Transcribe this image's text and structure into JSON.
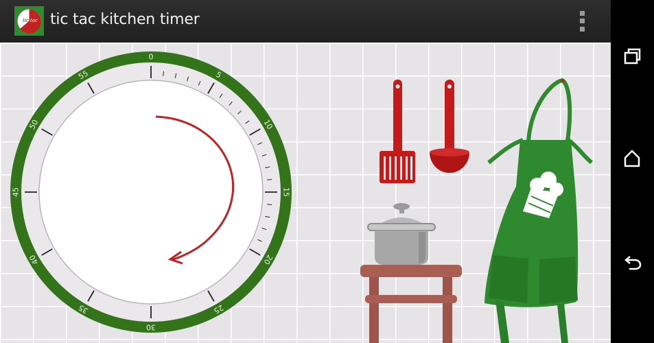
{
  "app": {
    "title": "tic tac kitchen timer",
    "icon_text_left": "tic",
    "icon_text_right": "tac"
  },
  "timer": {
    "minute_labels": [
      "0",
      "5",
      "10",
      "15",
      "20",
      "25",
      "30",
      "35",
      "40",
      "45",
      "50",
      "55"
    ],
    "direction_hint": "arrow-clockwise"
  },
  "colors": {
    "ring": "#33731a",
    "accent_red": "#c22222",
    "apron": "#2f8a2f",
    "stool": "#a35b52",
    "actionbar": "#262626"
  },
  "navigation": {
    "recents": "recents-icon",
    "home": "home-icon",
    "back": "back-icon"
  }
}
